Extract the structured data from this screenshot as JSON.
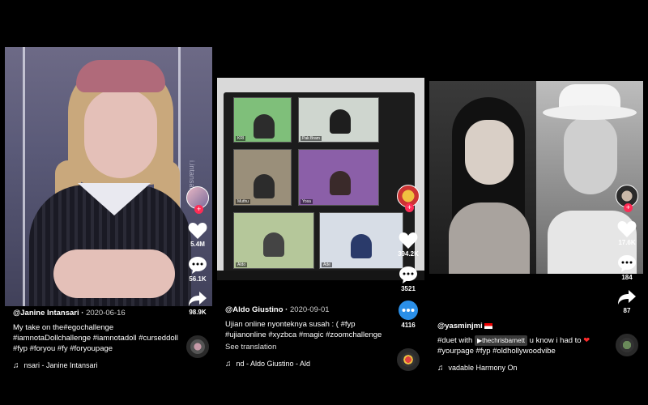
{
  "colors": {
    "tiktok_red": "#fe2c55",
    "comment_blue": "#2a8fe8",
    "text": "#ffffff"
  },
  "posts": [
    {
      "username": "@Janine Intansari",
      "date": "2020-06-16",
      "watermark": "i.intansari",
      "description": "My take on the#egochallenge #iamnotaDollchallenge #iamnotadoll #curseddoll #fyp #foryou #fy #foryoupage",
      "music": "nsari - Janine Intansari",
      "likes": "5.4M",
      "comments": "56.1K",
      "shares": "98.9K"
    },
    {
      "username": "@Aldo Giustino",
      "date": "2020-09-01",
      "description": "Ujian online nyonteknya susah : ( #fyp #ujianonline #xyzbca #magic #zoomchallenge",
      "see_translation": "See translation",
      "music": "nd - Aldo Giustino - Ald",
      "likes": "394.2K",
      "comments": "3521",
      "shares": "4116",
      "tile_labels": [
        "KRI",
        "Pak Bram",
        "Muthu",
        "Yosa",
        "Aldo",
        "Ade"
      ]
    },
    {
      "username": "@yasminjmi",
      "desc_prefix": "#duet with",
      "mention": "thechrisbarnett",
      "desc_middle": "u know i had to",
      "heart": "❤",
      "desc_suffix": "#yourpage #fyp #oldhollywoodvibe",
      "music": "vadable Harmony  On",
      "likes": "17.6K",
      "comments": "184",
      "shares": "87"
    }
  ]
}
